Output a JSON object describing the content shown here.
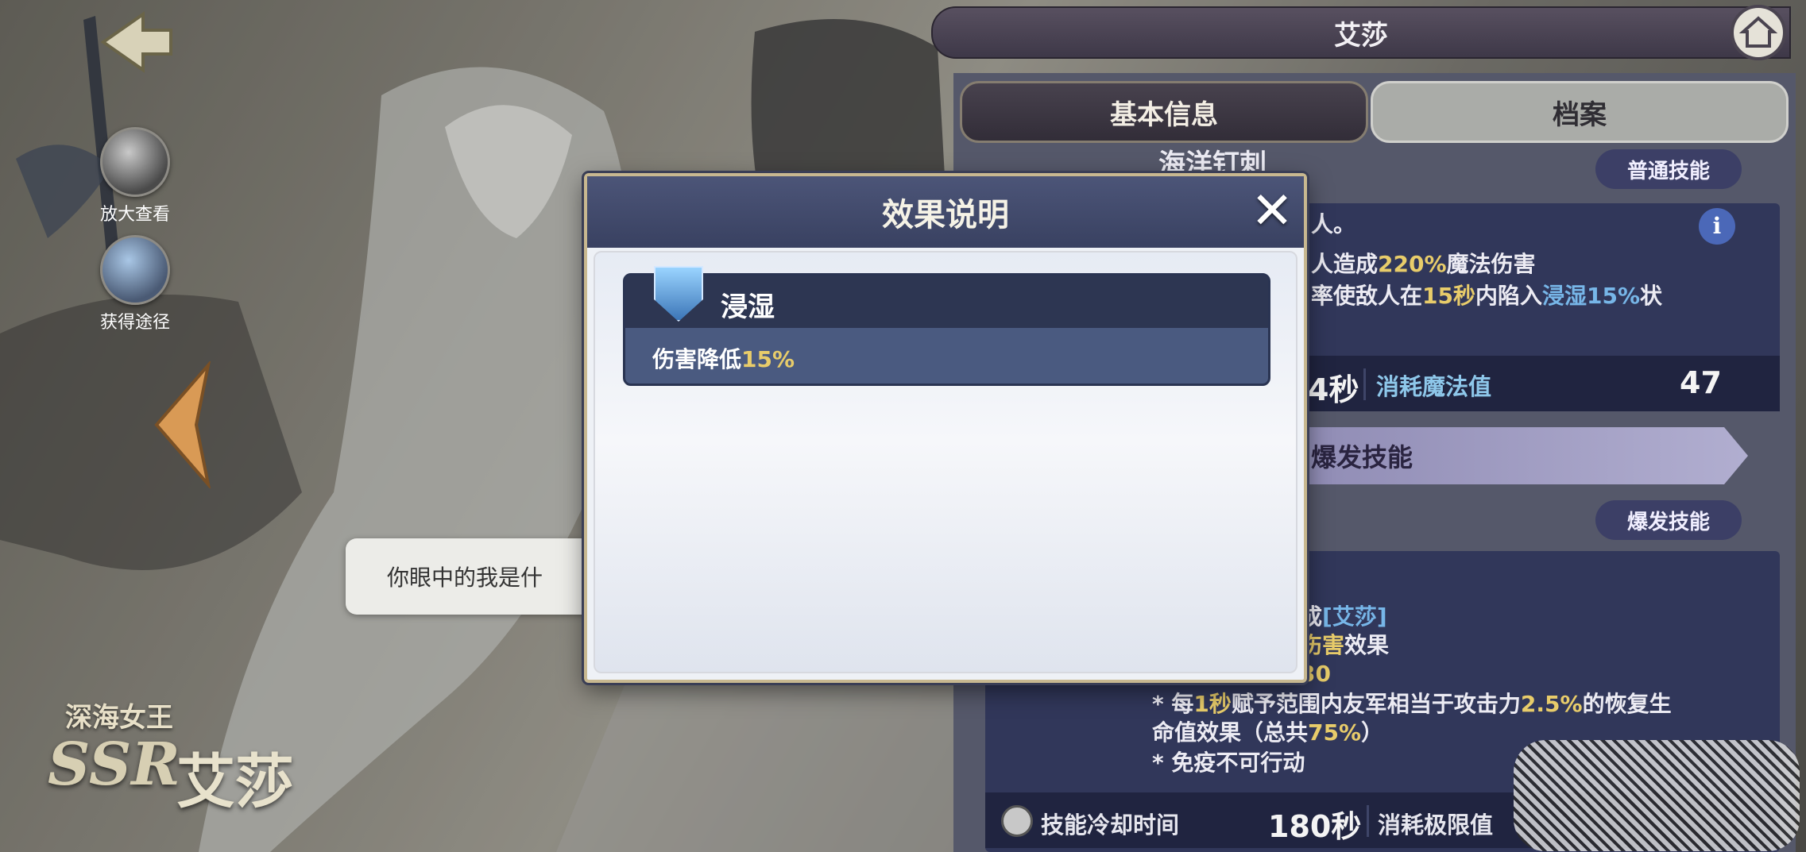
{
  "left_menu": {
    "zoom_label": "放大查看",
    "source_label": "获得途径"
  },
  "character": {
    "quote": "你眼中的我是什",
    "subtitle": "深海女王",
    "rarity": "SSR",
    "name": "艾莎"
  },
  "header": {
    "title": "艾莎"
  },
  "tabs": [
    {
      "label": "基本信息",
      "active": true
    },
    {
      "label": "档案",
      "active": false
    }
  ],
  "skill1": {
    "name_partial": "海洋钉刺",
    "type_badge": "普通技能",
    "line1": "人。",
    "line2_pre": "人造成",
    "line2_hl": "220%",
    "line2_post": "魔法伤害",
    "line3_pre": "率使敌人在",
    "line3_hl1": "15秒",
    "line3_mid": "内陷入",
    "line3_hl2": "浸湿15%",
    "line3_post": "状",
    "cooldown_partial": "4秒",
    "cost_label": "消耗魔法值",
    "cost_value": "47"
  },
  "burst_banner": {
    "label": "爆发技能"
  },
  "skill2": {
    "type_badge": "爆发技能",
    "line1_pre": "成",
    "line1_hl": "[艾莎]",
    "line2_hl": "伤害",
    "line2_post": "效果",
    "line3": "30",
    "line4_pre": "* 每",
    "line4_hl1": "1秒",
    "line4_mid": "赋予范围内友军相当于攻击力",
    "line4_hl2": "2.5%",
    "line4_post": "的恢复生",
    "line5_pre": "命值效果（总共",
    "line5_hl": "75%",
    "line5_post": "）",
    "line6": "* 免疫不可行动",
    "cooldown_label": "技能冷却时间",
    "cooldown_value": "180秒",
    "cost_label": "消耗极限值"
  },
  "modal": {
    "title": "效果说明",
    "effect_name": "浸湿",
    "effect_desc_pre": "伤害降低",
    "effect_desc_hl": "15%"
  },
  "colors": {
    "highlight_yellow": "#e8cc6a",
    "highlight_blue": "#77b6e8",
    "modal_header": "#394161"
  }
}
